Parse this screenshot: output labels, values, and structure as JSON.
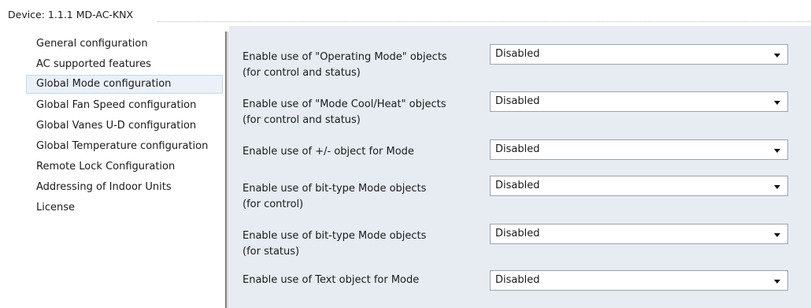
{
  "device_title": "Device: 1.1.1  MD-AC-KNX",
  "sidebar": {
    "items": [
      {
        "label": "General configuration"
      },
      {
        "label": "AC supported features"
      },
      {
        "label": "Global Mode configuration",
        "selected": true
      },
      {
        "label": "Global Fan Speed configuration"
      },
      {
        "label": "Global Vanes U-D configuration"
      },
      {
        "label": "Global Temperature configuration"
      },
      {
        "label": "Remote Lock Configuration"
      },
      {
        "label": "Addressing of Indoor Units"
      },
      {
        "label": "License"
      }
    ]
  },
  "params": [
    {
      "line1": "Enable use of \"Operating Mode\" objects",
      "line2": "(for control and status)",
      "value": "Disabled"
    },
    {
      "line1": "Enable use of \"Mode Cool/Heat\" objects",
      "line2": "(for control and status)",
      "value": "Disabled"
    },
    {
      "line1": "Enable use of +/- object for Mode",
      "line2": "",
      "value": "Disabled"
    },
    {
      "line1": "Enable use of bit-type Mode objects",
      "line2": "(for control)",
      "value": "Disabled"
    },
    {
      "line1": "Enable use of bit-type Mode objects",
      "line2": "(for status)",
      "value": "Disabled"
    },
    {
      "line1": "Enable use of Text object for Mode",
      "line2": "",
      "value": "Disabled"
    }
  ],
  "icons": {
    "dropdown_arrow": "chevron-down-icon"
  },
  "colors": {
    "panel_bg": "#e7ecf2",
    "selected_bg": "#eaf1f9",
    "selected_border": "#c7d6ea"
  }
}
